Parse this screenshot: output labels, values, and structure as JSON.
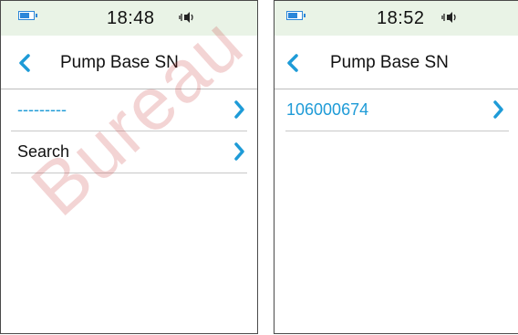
{
  "screens": [
    {
      "status": {
        "time": "18:48",
        "battery_level": 0.6
      },
      "title": "Pump Base SN",
      "items": [
        {
          "label": "---------",
          "style": "blue"
        },
        {
          "label": "Search",
          "style": "dark"
        }
      ]
    },
    {
      "status": {
        "time": "18:52",
        "battery_level": 0.6
      },
      "title": "Pump Base SN",
      "items": [
        {
          "label": "106000674",
          "style": "blue"
        }
      ]
    }
  ],
  "watermark": "Bureau",
  "colors": {
    "accent": "#1e9bd7",
    "status_bar_bg": "#e9f3e6",
    "battery": "#2b86d9"
  },
  "icons": [
    "battery-icon",
    "sound-icon",
    "back-icon",
    "chevron-right-icon"
  ]
}
